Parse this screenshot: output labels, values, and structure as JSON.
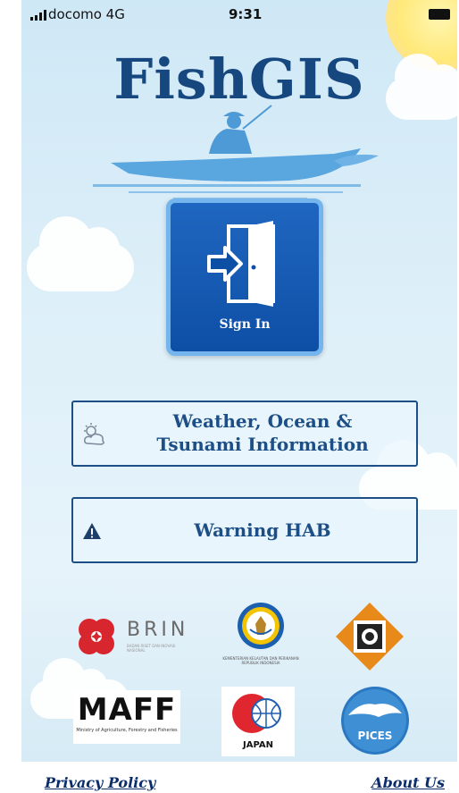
{
  "status_bar": {
    "carrier": "docomo  4G",
    "time": "9:31"
  },
  "app": {
    "title": "FishGIS"
  },
  "sign_in": {
    "label": "Sign In"
  },
  "weather_button": {
    "line1": "Weather, Ocean &",
    "line2": "Tsunami Information",
    "icon": "cloud-sun-icon"
  },
  "hab_button": {
    "label": "Warning HAB",
    "icon": "warning-icon"
  },
  "logos": {
    "brin": {
      "name": "BRIN",
      "subtitle": "BADAN RISET DAN INOVASI NASIONAL"
    },
    "kkp": {
      "subtitle": "KEMENTERIAN KELAUTAN DAN PERIKANAN REPUBLIK INDONESIA"
    },
    "maff": {
      "name": "MAFF",
      "subtitle": "Ministry of Agriculture, Forestry and Fisheries"
    },
    "japan": {
      "name": "JAPAN"
    },
    "pices": {
      "name": "PICES"
    }
  },
  "footer": {
    "privacy": "Privacy Policy",
    "about": "About Us"
  },
  "colors": {
    "title": "#16477f",
    "button_border": "#1d4f86",
    "signin_bg": "#0e4fa6",
    "link": "#0b2d6b"
  }
}
